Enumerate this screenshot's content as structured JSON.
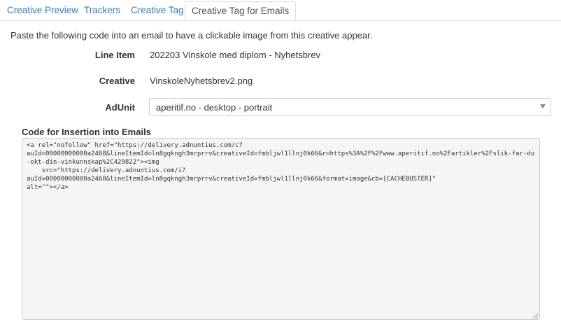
{
  "tabs": [
    {
      "label": "Creative Preview",
      "active": false
    },
    {
      "label": "Trackers",
      "active": false
    },
    {
      "label": "Creative Tag",
      "active": false
    },
    {
      "label": "Creative Tag for Emails",
      "active": true
    }
  ],
  "intro": "Paste the following code into an email to have a clickable image from this creative appear.",
  "fields": {
    "line_item": {
      "label": "Line Item",
      "value": "202203 Vinskole med diplom - Nyhetsbrev"
    },
    "creative": {
      "label": "Creative",
      "value": "VinskoleNyhetsbrev2.png"
    },
    "adunit": {
      "label": "AdUnit",
      "value": "aperitif.no - desktop - portrait"
    }
  },
  "code": {
    "label": "Code for Insertion into Emails",
    "value": "<a rel=\"nofollow\" href=\"https://delivery.adnuntius.com/c?\nauId=00000000000a2468&lineItemId=ln8gqkngh3mrprrv&creativeId=fmbljwl1llnj0k66&r=https%3A%2F%2Fwww.aperitif.no%2Fartikler%2Fslik-far-du-okt-din-vinkunnskap%2C429822\"><img\n    src=\"https://delivery.adnuntius.com/i?\nauId=00000000000a2468&lineItemId=ln8gqkngh3mrprrv&creativeId=fmbljwl1llnj0k66&format=image&cb=[CACHEBUSTER]\"\nalt=\"\"></a>"
  },
  "colors": {
    "link": "#337ab7",
    "text": "#333333",
    "border": "#dddddd",
    "code_bg": "#f5f5f5"
  }
}
